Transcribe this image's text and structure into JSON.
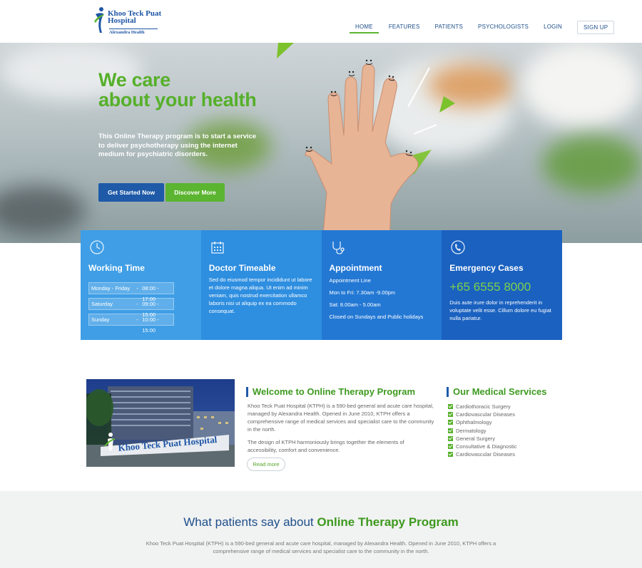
{
  "brand": {
    "name": "Khoo Teck Puat Hospital",
    "sub": "Alexandra Health"
  },
  "nav": [
    {
      "label": "HOME"
    },
    {
      "label": "FEATURES"
    },
    {
      "label": "PATIENTS"
    },
    {
      "label": "PSYCHOLOGISTS"
    },
    {
      "label": "LOGIN"
    },
    {
      "label": "SIGN UP"
    }
  ],
  "hero": {
    "title_line1": "We care",
    "title_line2": "about your health",
    "text": "This Online Therapy program is to start a service to deliver psychotherapy using the internet medium for psychiatric disorders.",
    "primary_button": "Get Started Now",
    "secondary_button": "Discover More"
  },
  "panels": {
    "working": {
      "title": "Working Time",
      "rows": [
        {
          "day": "Monday - Friday",
          "dash": "-",
          "time": "08:00 - 17:00"
        },
        {
          "day": "Saturday",
          "dash": "-",
          "time": "09:00 - 15:00"
        },
        {
          "day": "Sunday",
          "dash": "-",
          "time": "10:00 - 15:00"
        }
      ]
    },
    "doctor": {
      "title": "Doctor Timeable",
      "text": "Sed do eiusmod tempor incididunt ut labore et dolore magna aliqua. Ut enim ad minim veniam, quis nostrud exercitation ullamco laboris nisi ut aliquip ex ea commodo consequat."
    },
    "appointment": {
      "title": "Appointment",
      "line1": "Appointment Line",
      "line2": "Mon to Fri: 7.30am -9.00pm",
      "line3": "Sat: 8.00am - 5.00am",
      "line4": "Closed on Sundays and Public holidays"
    },
    "emergency": {
      "title": "Emergency Cases",
      "phone": "+65 6555 8000",
      "text": "Duis aute irure dolor in reprehenderit in voluptate velit esse. Cillum dolore eu fugiat nulla pariatur."
    }
  },
  "welcome": {
    "photo_sign": "Khoo Teck Puat Hospital",
    "title": "Welcome to Online Therapy Program",
    "para1": "Khoo Teck Puat Hospital (KTPH) is a 590-bed general and acute care hospital, managed by Alexandra Health. Opened in June 2010, KTPH offers a comprehensive range of medical services and specialist care to the community in the north.",
    "para2": "The design of KTPH harmoniously brings together the elements of accessibility, comfort and convenience.",
    "read_more": "Read more"
  },
  "services": {
    "title": "Our Medical Services",
    "items": [
      "Cardiothoracic Surgery",
      "Cardiovascular Diseases",
      "Ophthalmology",
      "Dermatology",
      "General Surgery",
      "Consultative & Diagnostic",
      "Cardiovascular Diseases"
    ]
  },
  "testimonials": {
    "title_plain": "What patients say about ",
    "title_highlight": "Online Therapy Program",
    "text": "Khoo Teck Puat Hospital (KTPH) is a 590-bed general and acute care hospital, managed by Alexandra Health. Opened in June 2010, KTPH offers a comprehensive range of medical services and specialist care to the community in the north."
  },
  "colors": {
    "brand_blue": "#1e5aa8",
    "brand_green": "#5cb531",
    "panel1": "#3f9ee6",
    "panel2": "#2e8ee0",
    "panel3": "#2378d4",
    "panel4": "#1a61c0"
  },
  "icons": {
    "working": "clock-icon",
    "doctor": "calendar-icon",
    "appointment": "stethoscope-icon",
    "emergency": "phone-icon"
  }
}
